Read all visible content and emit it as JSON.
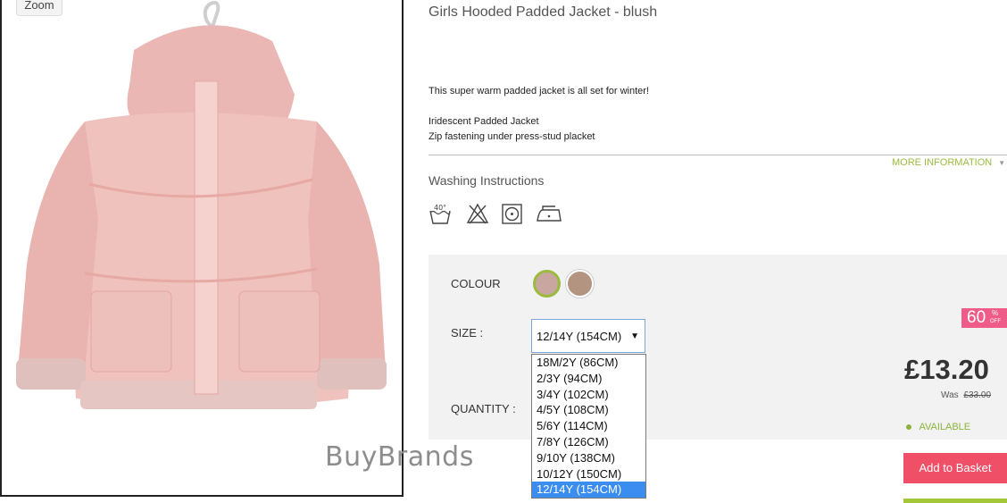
{
  "image": {
    "zoom_label": "Zoom"
  },
  "watermark": "BuyBrands",
  "product": {
    "title": "Girls Hooded Padded Jacket - blush",
    "description": [
      "This super warm padded jacket is all set for winter!",
      "Iridescent Padded Jacket",
      "Zip fastening under press-stud placket"
    ],
    "more_info": "MORE INFORMATION",
    "washing_title": "Washing Instructions",
    "washing_icons": [
      "wash-40-icon",
      "no-bleach-icon",
      "tumble-dry-icon",
      "iron-icon"
    ],
    "wash_temp": "40°"
  },
  "options": {
    "colour_label": "COLOUR",
    "colours": [
      {
        "hex": "#c9a6a0",
        "selected": true
      },
      {
        "hex": "#b29480",
        "selected": false
      }
    ],
    "size_label": "SIZE :",
    "size_selected": "12/14Y (154CM)",
    "sizes": [
      "18M/2Y (86CM)",
      "2/3Y (94CM)",
      "3/4Y (102CM)",
      "4/5Y (108CM)",
      "5/6Y (114CM)",
      "7/8Y (126CM)",
      "9/10Y (138CM)",
      "10/12Y (150CM)",
      "12/14Y (154CM)"
    ],
    "quantity_label": "QUANTITY :"
  },
  "pricing": {
    "discount": "60",
    "discount_pct": "%",
    "discount_off": "OFF",
    "price": "£13.20",
    "was_label": "Was",
    "was_price": "£33.00",
    "availability": "AVAILABLE",
    "add_to_basket": "Add to Basket"
  },
  "colors": {
    "accent_green": "#9bbb3f",
    "basket": "#ef4f67",
    "badge": "#ef5c8a",
    "dropdown_selected": "#3b8df0"
  }
}
